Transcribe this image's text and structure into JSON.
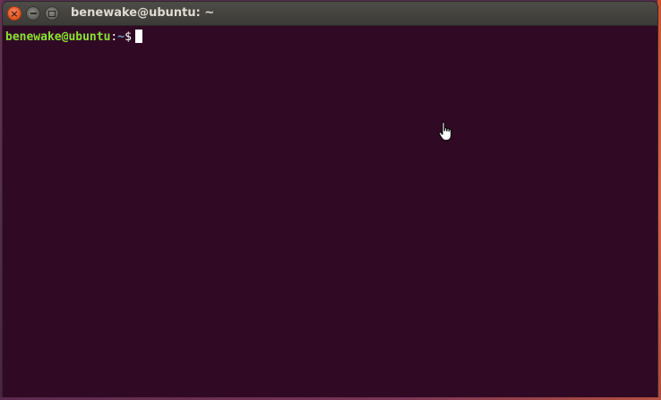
{
  "window": {
    "title": "benewake@ubuntu: ~",
    "close_icon": "close-icon",
    "minimize_icon": "minimize-icon",
    "maximize_icon": "maximize-icon",
    "close_glyph": "×"
  },
  "terminal": {
    "user_host": "benewake@ubuntu",
    "separator": ":",
    "path": "~",
    "prompt_symbol": "$",
    "background_color": "#300a24",
    "user_host_color": "#8ae234",
    "path_color": "#729fcf"
  },
  "pointer": {
    "icon": "hand-pointer-icon"
  }
}
